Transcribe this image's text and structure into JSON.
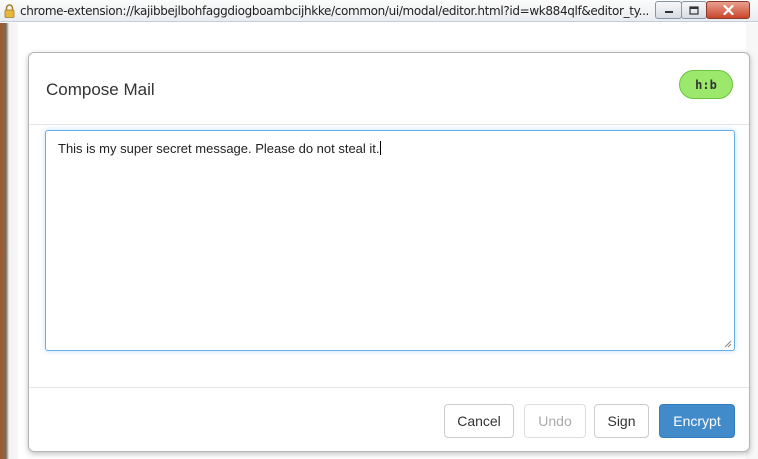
{
  "window": {
    "url": "chrome-extension://kajibbejlbohfaggdiogboambcijhkke/common/ui/modal/editor.html?id=wk884qlf&editor_ty..."
  },
  "modal": {
    "title": "Compose Mail",
    "badge": "h:b",
    "message": "This is my super secret message. Please do not steal it."
  },
  "footer": {
    "cancel_label": "Cancel",
    "undo_label": "Undo",
    "sign_label": "Sign",
    "encrypt_label": "Encrypt"
  },
  "colors": {
    "badge": "#9be86d",
    "primary": "#428bca",
    "focus": "#66afe9"
  },
  "icons": {
    "title_icon": "lock-icon",
    "minimize": "minimize-icon",
    "maximize": "maximize-icon",
    "close": "close-icon"
  }
}
